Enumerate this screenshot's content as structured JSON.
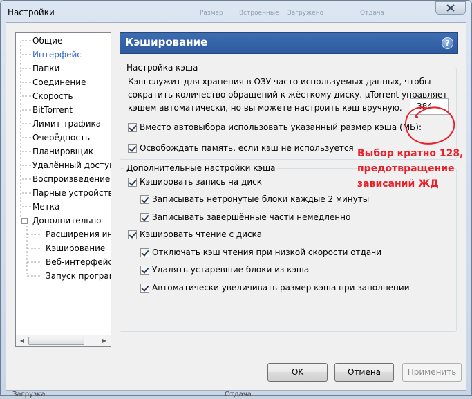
{
  "window": {
    "title": "Настройки",
    "background_tabs": [
      "Размер",
      "Встроенные",
      "Загружено",
      "Отдача"
    ]
  },
  "tree": {
    "items": [
      {
        "label": "Общие",
        "level": 0,
        "selected": false
      },
      {
        "label": "Интерфейс",
        "level": 0,
        "selected": true
      },
      {
        "label": "Папки",
        "level": 0,
        "selected": false
      },
      {
        "label": "Соединение",
        "level": 0,
        "selected": false
      },
      {
        "label": "Скорость",
        "level": 0,
        "selected": false
      },
      {
        "label": "BitTorrent",
        "level": 0,
        "selected": false
      },
      {
        "label": "Лимит трафика",
        "level": 0,
        "selected": false
      },
      {
        "label": "Очерёдность",
        "level": 0,
        "selected": false
      },
      {
        "label": "Планировщик",
        "level": 0,
        "selected": false
      },
      {
        "label": "Удалённый доступ",
        "level": 0,
        "selected": false
      },
      {
        "label": "Воспроизведение",
        "level": 0,
        "selected": false
      },
      {
        "label": "Парные устройства",
        "level": 0,
        "selected": false
      },
      {
        "label": "Метка",
        "level": 0,
        "selected": false
      },
      {
        "label": "Дополнительно",
        "level": 0,
        "selected": false,
        "expanded": true
      },
      {
        "label": "Расширения интерфейса",
        "level": 1,
        "selected": false
      },
      {
        "label": "Кэширование",
        "level": 1,
        "selected": false
      },
      {
        "label": "Веб-интерфейс",
        "level": 1,
        "selected": false
      },
      {
        "label": "Запуск программ",
        "level": 1,
        "selected": false
      }
    ]
  },
  "panel": {
    "title": "Кэширование",
    "help_icon": "?"
  },
  "cache_group": {
    "legend": "Настройка кэша",
    "description": "Кэш служит для хранения в ОЗУ часто используемых данных, чтобы сократить количество обращений к жёсткому диску. µTorrent управляет кэшем автоматически, но вы можете настроить кэш вручную.",
    "override_size": {
      "label": "Вместо автовыбора использовать указанный размер кэша (МБ):",
      "checked": true
    },
    "size_value": "384",
    "free_memory": {
      "label": "Освобождать память, если кэш не используется",
      "checked": true
    }
  },
  "advanced_group": {
    "legend": "Дополнительные настройки кэша",
    "options": [
      {
        "label": "Кэшировать запись на диск",
        "checked": true,
        "indent": 0
      },
      {
        "label": "Записывать нетронутые блоки каждые 2 минуты",
        "checked": true,
        "indent": 1
      },
      {
        "label": "Записывать завершённые части немедленно",
        "checked": true,
        "indent": 1
      },
      {
        "label": "Кэшировать чтение с диска",
        "checked": true,
        "indent": 0
      },
      {
        "label": "Отключать кэш чтения при низкой скорости отдачи",
        "checked": true,
        "indent": 1
      },
      {
        "label": "Удалять устаревшие блоки из кэша",
        "checked": true,
        "indent": 1
      },
      {
        "label": "Автоматически увеличивать размер кэша при заполнении",
        "checked": true,
        "indent": 1
      }
    ]
  },
  "annotation": {
    "text_lines": [
      "Выбор кратно 128,",
      "предотвращение",
      "зависаний ЖД"
    ],
    "color": "#e8202a"
  },
  "buttons": {
    "ok": "OK",
    "cancel": "Отмена",
    "apply": "Применить"
  },
  "status_bar_fragments": [
    "Загрузка",
    "Отдача"
  ],
  "colors": {
    "header_bg": "#2d5aa0",
    "selected_tree_text": "#3366cc",
    "annotation_red": "#e8202a"
  }
}
